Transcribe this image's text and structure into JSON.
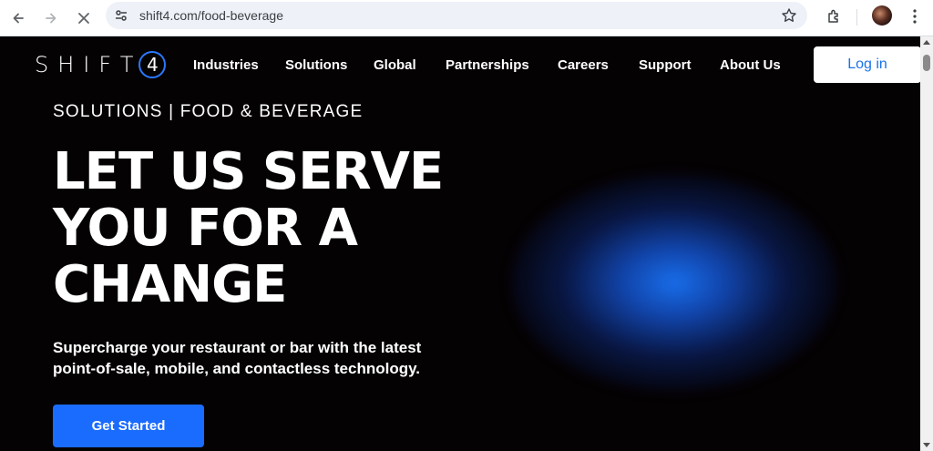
{
  "browser": {
    "url": "shift4.com/food-beverage",
    "back_icon": "back-arrow-icon",
    "forward_icon": "forward-arrow-icon",
    "stop_icon": "close-icon"
  },
  "header": {
    "logo_text": "SHIFT",
    "logo_number": "4",
    "nav": [
      "Industries",
      "Solutions",
      "Global",
      "Partnerships",
      "Careers",
      "Support",
      "About Us"
    ],
    "login_label": "Log in"
  },
  "hero": {
    "eyebrow": "SOLUTIONS | FOOD & BEVERAGE",
    "headline_lines": [
      "LET US SERVE",
      "YOU FOR A",
      "CHANGE"
    ],
    "subline_1": "Supercharge your restaurant or bar with the latest",
    "subline_2": "point-of-sale, mobile, and contactless technology.",
    "cta_label": "Get Started"
  },
  "colors": {
    "accent": "#1a6cff",
    "login_text": "#1a73e8",
    "background": "#050203"
  }
}
